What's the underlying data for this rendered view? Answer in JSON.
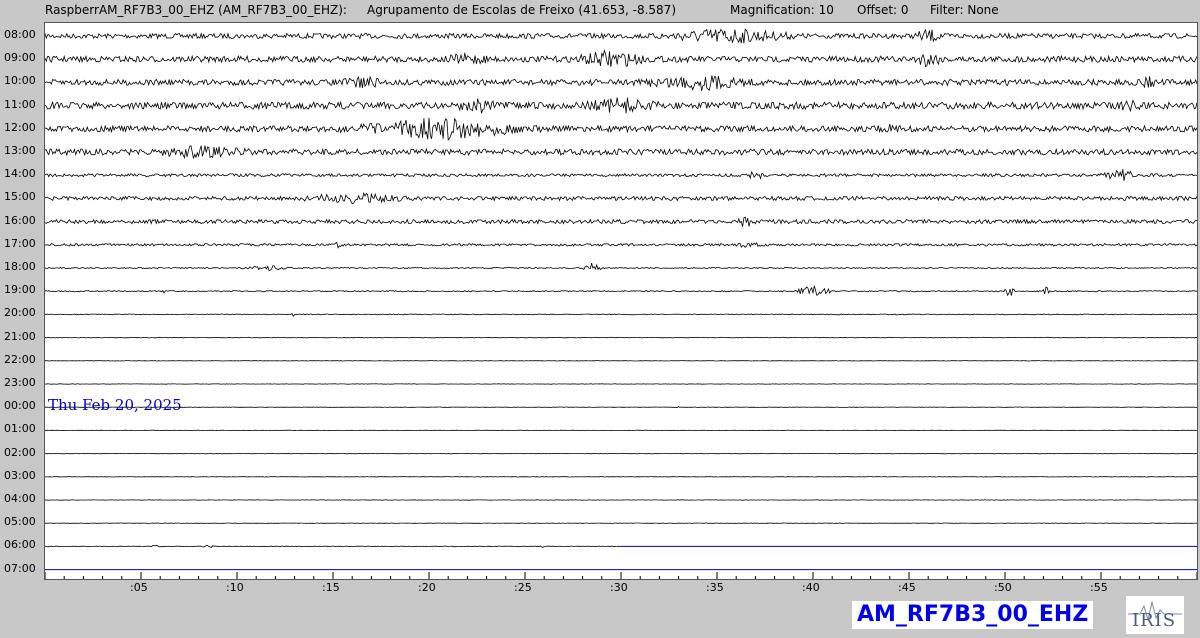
{
  "header": {
    "station": "RaspberrAM_RF7B3_00_EHZ (AM_RF7B3_00_EHZ):",
    "location": "Agrupamento de Escolas de Freixo (41.653, -8.587)",
    "magnification": "Magnification: 10",
    "offset": "Offset: 0",
    "filter": "Filter: None"
  },
  "hour_labels": [
    "08:00",
    "09:00",
    "10:00",
    "11:00",
    "12:00",
    "13:00",
    "14:00",
    "15:00",
    "16:00",
    "17:00",
    "18:00",
    "19:00",
    "20:00",
    "21:00",
    "22:00",
    "23:00",
    "00:00",
    "01:00",
    "02:00",
    "03:00",
    "04:00",
    "05:00",
    "06:00",
    "07:00"
  ],
  "minute_labels": [
    ":05",
    ":10",
    ":15",
    ":20",
    ":25",
    ":30",
    ":35",
    ":40",
    ":45",
    ":50",
    ":55"
  ],
  "date_label": "Thu Feb 20, 2025",
  "station_code": "AM_RF7B3_00_EHZ",
  "logo": {
    "text": "IRIS"
  },
  "colors": {
    "trace": "#000000",
    "current_trace": "#0000cc",
    "date_label": "#0000cc",
    "background": "#c8c8c8"
  },
  "trace_activity": [
    {
      "hour": "08:00",
      "noise": 2.5,
      "bursts": [
        [
          31,
          40,
          9
        ],
        [
          45,
          47,
          8
        ]
      ]
    },
    {
      "hour": "09:00",
      "noise": 3,
      "bursts": [
        [
          20,
          24,
          7
        ],
        [
          27,
          32,
          10
        ],
        [
          45,
          47,
          9
        ]
      ]
    },
    {
      "hour": "10:00",
      "noise": 3,
      "bursts": [
        [
          15,
          18,
          8
        ],
        [
          30,
          38,
          9
        ],
        [
          57,
          58,
          8
        ]
      ]
    },
    {
      "hour": "11:00",
      "noise": 3.5,
      "bursts": [
        [
          21,
          24,
          9
        ],
        [
          27,
          33,
          9
        ],
        [
          55,
          58,
          6
        ]
      ]
    },
    {
      "hour": "12:00",
      "noise": 3,
      "bursts": [
        [
          15,
          26,
          12
        ],
        [
          42,
          46,
          5
        ]
      ]
    },
    {
      "hour": "13:00",
      "noise": 3,
      "bursts": [
        [
          4,
          12,
          7
        ]
      ]
    },
    {
      "hour": "14:00",
      "noise": 1.5,
      "bursts": [
        [
          36.5,
          37.5,
          6
        ],
        [
          55,
          57,
          7
        ]
      ]
    },
    {
      "hour": "15:00",
      "noise": 2,
      "bursts": [
        [
          12,
          20,
          6
        ]
      ]
    },
    {
      "hour": "16:00",
      "noise": 2,
      "bursts": [
        [
          36,
          37,
          8
        ]
      ]
    },
    {
      "hour": "17:00",
      "noise": 1.2,
      "bursts": [
        [
          15,
          15.5,
          4
        ],
        [
          35,
          38,
          3
        ]
      ]
    },
    {
      "hour": "18:00",
      "noise": 0.6,
      "bursts": [
        [
          10,
          13,
          3
        ],
        [
          28,
          29,
          6
        ]
      ]
    },
    {
      "hour": "19:00",
      "noise": 0.6,
      "bursts": [
        [
          6,
          6.5,
          3
        ],
        [
          39,
          41,
          7
        ],
        [
          50,
          50.5,
          7
        ],
        [
          52,
          52.3,
          6
        ]
      ]
    },
    {
      "hour": "20:00",
      "noise": 0.4,
      "bursts": [
        [
          12.8,
          13.1,
          4
        ]
      ]
    },
    {
      "hour": "21:00",
      "noise": 0.3,
      "bursts": []
    },
    {
      "hour": "22:00",
      "noise": 0.2,
      "bursts": []
    },
    {
      "hour": "23:00",
      "noise": 0.2,
      "bursts": []
    },
    {
      "hour": "00:00",
      "noise": 0.2,
      "bursts": [
        [
          32.8,
          33,
          2
        ]
      ]
    },
    {
      "hour": "01:00",
      "noise": 0.2,
      "bursts": []
    },
    {
      "hour": "02:00",
      "noise": 0.2,
      "bursts": []
    },
    {
      "hour": "03:00",
      "noise": 0.2,
      "bursts": []
    },
    {
      "hour": "04:00",
      "noise": 0.2,
      "bursts": []
    },
    {
      "hour": "05:00",
      "noise": 0.2,
      "bursts": []
    },
    {
      "hour": "06:00",
      "noise": 0.3,
      "bursts": [
        [
          5.5,
          6,
          1.5
        ],
        [
          8,
          9,
          1.5
        ],
        [
          25.8,
          26,
          1.5
        ]
      ],
      "current_until": 30
    },
    {
      "hour": "07:00",
      "noise": 0.2,
      "bursts": [],
      "current_from": 0
    }
  ]
}
